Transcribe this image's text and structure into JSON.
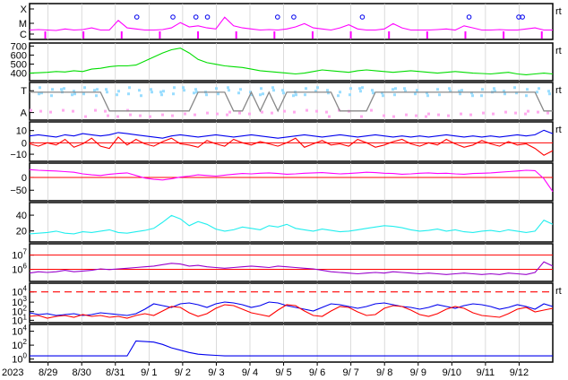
{
  "year_label": "2023",
  "date_ticks": [
    "8/29",
    "8/30",
    "8/31",
    "9/ 1",
    "9/ 2",
    "9/ 3",
    "9/ 4",
    "9/ 5",
    "9/ 6",
    "9/ 7",
    "9/ 8",
    "9/ 9",
    "9/10",
    "9/11",
    "9/12"
  ],
  "right_marker": "rt",
  "colors": {
    "magenta": "#ff00ff",
    "green": "#00dd00",
    "lightblue": "#99ddff",
    "pink": "#ffaaee",
    "gray": "#888888",
    "blue": "#0000ee",
    "red": "#ff0000",
    "cyan": "#22eeee",
    "purple": "#9900cc"
  },
  "chart_data": [
    {
      "type": "line",
      "panel": "xray-flare",
      "y_tick_labels": [
        "X",
        "M",
        "C"
      ],
      "series": [
        {
          "color": "#ff00ff",
          "values": [
            0.1,
            0.12,
            0.1,
            0.08,
            0.15,
            0.1,
            0.12,
            0.2,
            0.1,
            0.1,
            0.55,
            0.2,
            0.15,
            0.1,
            0.1,
            0.12,
            0.2,
            0.45,
            0.25,
            0.3,
            0.2,
            0.15,
            0.7,
            0.3,
            0.2,
            0.15,
            0.1,
            0.12,
            0.1,
            0.15,
            0.25,
            0.4,
            0.2,
            0.15,
            0.1,
            0.2,
            0.35,
            0.15,
            0.1,
            0.1,
            0.15,
            0.4,
            0.2,
            0.1,
            0.1,
            0.1,
            0.12,
            0.15,
            0.1,
            0.3,
            0.2,
            0.1,
            0.1,
            0.12,
            0.1,
            0.1,
            0.15,
            0.2,
            0.1,
            0.1
          ]
        }
      ],
      "event_marks": [
        0.205,
        0.274,
        0.318,
        0.34,
        0.474,
        0.505,
        0.636,
        0.84,
        0.935,
        0.942
      ]
    },
    {
      "type": "line",
      "panel": "solar-wind-speed",
      "y_tick_labels": [
        "700",
        "600",
        "500",
        "400"
      ],
      "ylim": [
        330,
        730
      ],
      "series": [
        {
          "color": "#00dd00",
          "values": [
            390,
            395,
            400,
            410,
            405,
            420,
            410,
            440,
            450,
            470,
            480,
            480,
            490,
            540,
            590,
            640,
            680,
            700,
            640,
            560,
            520,
            500,
            480,
            470,
            460,
            440,
            420,
            410,
            400,
            390,
            380,
            390,
            410,
            430,
            420,
            410,
            400,
            420,
            430,
            420,
            410,
            400,
            410,
            420,
            410,
            400,
            390,
            400,
            410,
            400,
            390,
            385,
            380,
            390,
            400,
            380,
            370,
            380,
            390,
            380
          ]
        }
      ]
    },
    {
      "type": "line",
      "panel": "imf-sector",
      "y_tick_labels": [
        "T",
        "A"
      ],
      "series": [
        {
          "color": "#888888",
          "values": [
            1,
            1,
            1,
            1,
            1,
            1,
            1,
            1,
            1,
            0,
            0,
            0,
            0,
            0,
            0,
            0,
            0,
            0,
            0,
            1,
            1,
            1,
            1,
            0,
            0,
            1,
            0,
            1,
            0,
            1,
            1,
            1,
            1,
            1,
            1,
            0,
            0,
            0,
            0,
            1,
            1,
            1,
            1,
            1,
            1,
            1,
            1,
            1,
            1,
            1,
            1,
            1,
            1,
            1,
            1,
            1,
            1,
            1,
            0,
            0
          ]
        }
      ]
    },
    {
      "type": "line",
      "panel": "imf-components",
      "y_tick_labels": [
        "10",
        "0",
        "−10"
      ],
      "ylim": [
        -15,
        15
      ],
      "series": [
        {
          "color": "#0000ee",
          "values": [
            5,
            6,
            5,
            4,
            6,
            5,
            7,
            6,
            5,
            6,
            8,
            7,
            6,
            5,
            4,
            3,
            5,
            6,
            5,
            4,
            5,
            6,
            5,
            4,
            5,
            6,
            5,
            4,
            3,
            4,
            5,
            6,
            5,
            4,
            5,
            6,
            5,
            4,
            5,
            6,
            5,
            4,
            5,
            4,
            5,
            4,
            5,
            6,
            5,
            4,
            5,
            4,
            5,
            4,
            5,
            6,
            5,
            6,
            10,
            7
          ]
        },
        {
          "color": "#ff0000",
          "values": [
            -2,
            -4,
            -1,
            -3,
            2,
            -5,
            -2,
            3,
            -4,
            -6,
            4,
            -3,
            2,
            -2,
            -4,
            0,
            3,
            -2,
            -3,
            -5,
            1,
            -2,
            -4,
            2,
            -1,
            -3,
            0,
            -2,
            -4,
            -1,
            3,
            -5,
            -2,
            1,
            -3,
            -2,
            -4,
            2,
            -1,
            -5,
            -3,
            0,
            2,
            -2,
            -4,
            -1,
            -3,
            2,
            -2,
            -5,
            -3,
            1,
            -2,
            -4,
            0,
            -3,
            -2,
            -6,
            -12,
            -8
          ]
        }
      ]
    },
    {
      "type": "line",
      "panel": "dst-index",
      "y_tick_labels": [
        "0",
        "−50"
      ],
      "ylim": [
        -80,
        20
      ],
      "series": [
        {
          "color": "#ff00ff",
          "values": [
            8,
            6,
            5,
            4,
            2,
            0,
            -5,
            -8,
            -10,
            -6,
            -4,
            -2,
            -10,
            -18,
            -22,
            -24,
            -20,
            -15,
            -12,
            -8,
            -10,
            -12,
            -9,
            -6,
            -4,
            -5,
            -3,
            -2,
            -4,
            -6,
            -5,
            -3,
            -2,
            -1,
            -3,
            -5,
            -4,
            -2,
            0,
            -1,
            -3,
            -4,
            -6,
            -5,
            -3,
            -2,
            -4,
            -3,
            -5,
            -6,
            -4,
            -3,
            -2,
            0,
            2,
            4,
            6,
            5,
            -20,
            -60
          ]
        }
      ]
    },
    {
      "type": "line",
      "panel": "proton-density",
      "y_tick_labels": [
        "40",
        "20"
      ],
      "ylim": [
        0,
        50
      ],
      "series": [
        {
          "color": "#22eeee",
          "values": [
            8,
            9,
            10,
            12,
            9,
            8,
            11,
            10,
            12,
            14,
            10,
            9,
            11,
            13,
            16,
            25,
            35,
            30,
            20,
            26,
            22,
            15,
            12,
            14,
            18,
            16,
            14,
            20,
            18,
            22,
            16,
            14,
            12,
            15,
            13,
            11,
            12,
            14,
            16,
            18,
            20,
            19,
            17,
            14,
            12,
            13,
            15,
            12,
            14,
            11,
            10,
            12,
            13,
            11,
            14,
            12,
            10,
            12,
            28,
            22
          ]
        }
      ]
    },
    {
      "type": "line",
      "panel": "proton-temperature",
      "y_tick_labels": [
        "10^7",
        "10^6"
      ],
      "series": [
        {
          "color": "#9900cc",
          "values": [
            5.4,
            5.5,
            5.45,
            5.5,
            5.6,
            5.5,
            5.55,
            5.6,
            5.7,
            5.65,
            5.7,
            5.75,
            5.8,
            5.85,
            5.9,
            6.0,
            6.1,
            6.05,
            5.9,
            5.95,
            5.85,
            5.8,
            5.75,
            5.8,
            5.85,
            5.9,
            5.85,
            5.8,
            5.9,
            5.85,
            5.8,
            5.75,
            5.7,
            5.6,
            5.5,
            5.45,
            5.4,
            5.35,
            5.4,
            5.45,
            5.4,
            5.5,
            5.45,
            5.4,
            5.35,
            5.4,
            5.35,
            5.3,
            5.35,
            5.4,
            5.35,
            5.3,
            5.35,
            5.3,
            5.4,
            5.35,
            5.3,
            5.45,
            6.2,
            5.9
          ]
        }
      ]
    },
    {
      "type": "line",
      "panel": "electron-flux",
      "y_tick_labels": [
        "10^4",
        "10^3",
        "10^2",
        "10^1"
      ],
      "threshold": 4,
      "series": [
        {
          "color": "#0000ee",
          "values": [
            1.6,
            1.4,
            1.5,
            1.3,
            1.4,
            1.5,
            1.3,
            1.4,
            1.6,
            1.5,
            1.4,
            1.3,
            1.5,
            2.0,
            2.6,
            2.4,
            2.2,
            2.6,
            2.7,
            2.5,
            2.2,
            2.6,
            2.8,
            2.7,
            2.5,
            2.2,
            2.4,
            2.8,
            2.7,
            2.4,
            2.2,
            2.0,
            1.8,
            2.2,
            2.6,
            2.5,
            2.3,
            2.1,
            2.3,
            2.6,
            2.7,
            2.5,
            2.3,
            2.2,
            2.0,
            2.2,
            2.5,
            2.3,
            2.1,
            2.4,
            2.6,
            2.5,
            2.3,
            2.0,
            2.2,
            2.5,
            2.3,
            2.0,
            2.6,
            2.3
          ]
        },
        {
          "color": "#ff0000",
          "values": [
            1.2,
            1.3,
            1.0,
            1.2,
            1.3,
            1.1,
            1.4,
            1.2,
            1.3,
            1.1,
            1.2,
            1.0,
            1.3,
            1.5,
            1.3,
            1.8,
            2.3,
            2.2,
            1.6,
            1.2,
            1.5,
            2.1,
            2.5,
            2.4,
            2.0,
            1.6,
            1.4,
            1.2,
            1.9,
            2.5,
            2.4,
            1.8,
            1.3,
            1.2,
            1.8,
            2.3,
            2.2,
            1.7,
            1.3,
            1.4,
            2.1,
            2.4,
            2.3,
            1.9,
            1.4,
            1.2,
            1.5,
            2.0,
            2.3,
            2.1,
            1.6,
            1.3,
            1.2,
            1.1,
            1.5,
            2.0,
            2.2,
            1.7,
            1.9,
            2.1
          ]
        }
      ]
    },
    {
      "type": "line",
      "panel": "proton-flux",
      "y_tick_labels": [
        "10^4",
        "10^2",
        "10^0"
      ],
      "series": [
        {
          "color": "#0000ee",
          "values": [
            -0.4,
            -0.4,
            -0.4,
            -0.4,
            -0.4,
            -0.4,
            -0.4,
            -0.4,
            -0.4,
            -0.4,
            -0.4,
            -0.4,
            2.2,
            2.1,
            2.0,
            1.6,
            1.0,
            0.6,
            0.2,
            -0.1,
            -0.2,
            -0.3,
            -0.4,
            -0.4,
            -0.4,
            -0.4,
            -0.4,
            -0.4,
            -0.4,
            -0.4,
            -0.4,
            -0.4,
            -0.4,
            -0.4,
            -0.4,
            -0.4,
            -0.4,
            -0.4,
            -0.4,
            -0.4,
            -0.4,
            -0.4,
            -0.4,
            -0.4,
            -0.4,
            -0.4,
            -0.4,
            -0.4,
            -0.4,
            -0.4,
            -0.4,
            -0.4,
            -0.4,
            -0.4,
            -0.4,
            -0.4,
            -0.4,
            -0.4,
            -0.4,
            -0.4
          ]
        }
      ]
    }
  ]
}
